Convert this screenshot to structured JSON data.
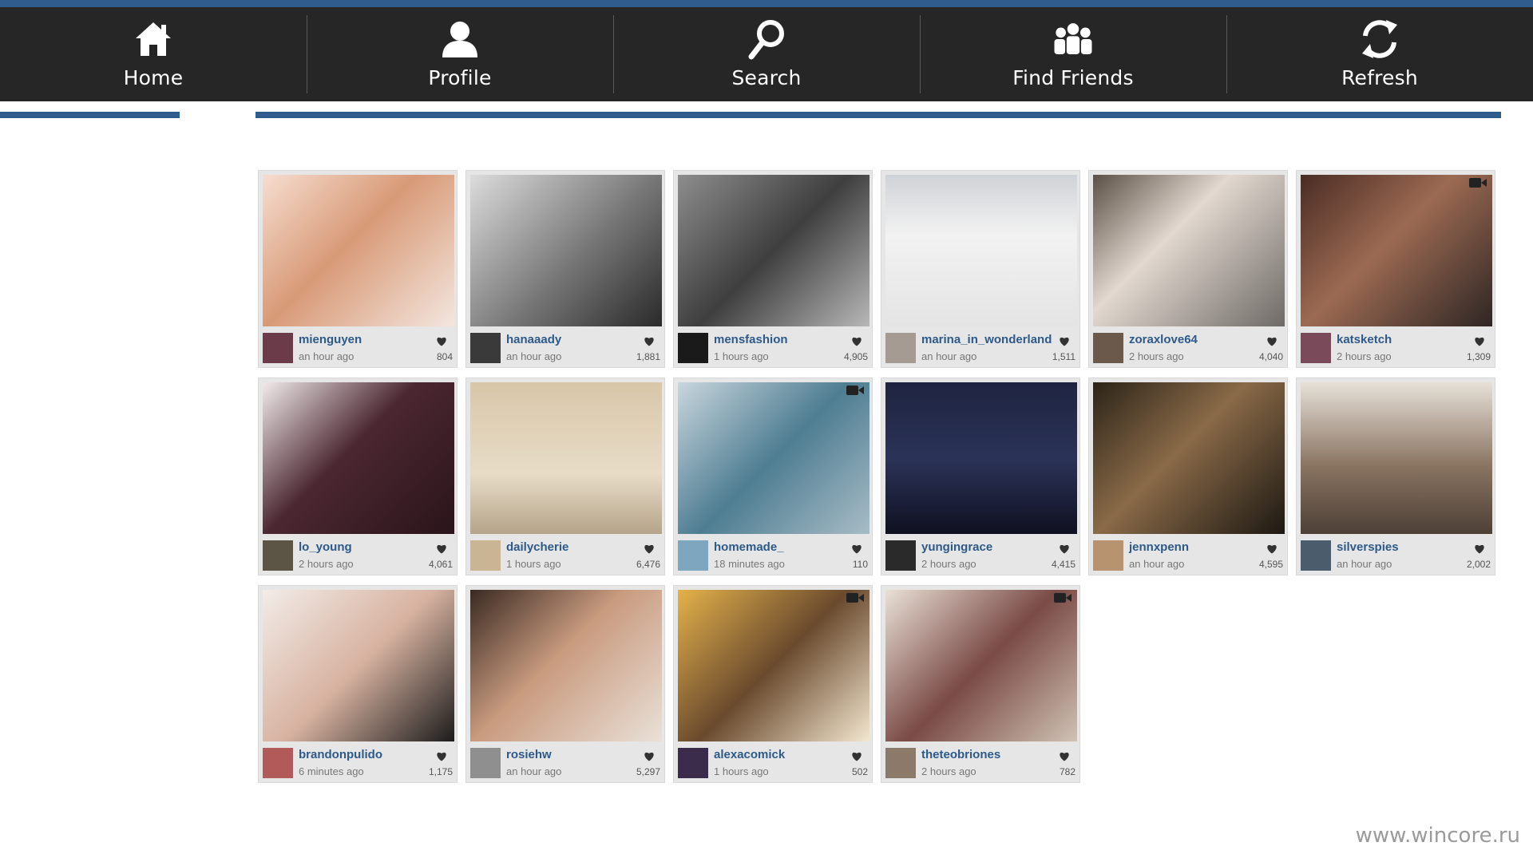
{
  "nav": {
    "items": [
      {
        "label": "Home",
        "icon": "home-icon"
      },
      {
        "label": "Profile",
        "icon": "profile-icon"
      },
      {
        "label": "Search",
        "icon": "search-icon"
      },
      {
        "label": "Find Friends",
        "icon": "friends-icon"
      },
      {
        "label": "Refresh",
        "icon": "refresh-icon"
      }
    ]
  },
  "colors": {
    "accent": "#2f5c8c",
    "appbar": "#262626",
    "username": "#2d5a8a"
  },
  "photos": [
    {
      "user": "mienguyen",
      "time": "an hour ago",
      "likes": "804",
      "bg": "linear-gradient(135deg,#f6ddd0,#d89a77 45%,#f3e6df)",
      "avatar": "#6b3b4a",
      "video": false
    },
    {
      "user": "hanaaady",
      "time": "an hour ago",
      "likes": "1,881",
      "bg": "linear-gradient(135deg,#dcdcdc,#777 55%,#2a2a2a)",
      "avatar": "#3a3a3a",
      "video": false
    },
    {
      "user": "mensfashion",
      "time": "1 hours ago",
      "likes": "4,905",
      "bg": "linear-gradient(135deg,#8d8d8d,#3f3f3f 50%,#b8b8b8)",
      "avatar": "#1a1a1a",
      "video": false
    },
    {
      "user": "marina_in_wonderland",
      "time": "an hour ago",
      "likes": "1,511",
      "bg": "linear-gradient(180deg,#cfd2d6,#f2f2f2 40%,#e4e4e4)",
      "avatar": "#a59b92",
      "video": false
    },
    {
      "user": "zoraxlove64",
      "time": "2 hours ago",
      "likes": "4,040",
      "bg": "linear-gradient(135deg,#5a5046,#e2d8cf 40%,#6e6a66)",
      "avatar": "#6b5a4c",
      "video": false
    },
    {
      "user": "katsketch",
      "time": "2 hours ago",
      "likes": "1,309",
      "bg": "linear-gradient(135deg,#4a2c24,#9c6a52 45%,#2e2624)",
      "avatar": "#7a4a5a",
      "video": true
    },
    {
      "user": "lo_young",
      "time": "2 hours ago",
      "likes": "4,061",
      "bg": "linear-gradient(135deg,#f0eaea,#4b2731 45%,#2a141a)",
      "avatar": "#5c5444",
      "video": false
    },
    {
      "user": "dailycherie",
      "time": "1 hours ago",
      "likes": "6,476",
      "bg": "linear-gradient(180deg,#d8c6a8,#e8dcc7 60%,#b5a48a)",
      "avatar": "#c9b593",
      "video": false
    },
    {
      "user": "homemade_",
      "time": "18 minutes ago",
      "likes": "110",
      "bg": "linear-gradient(135deg,#c9d6dd,#4e7d92 50%,#a8bcc6)",
      "avatar": "#7fa6bf",
      "video": true
    },
    {
      "user": "yungingrace",
      "time": "2 hours ago",
      "likes": "4,415",
      "bg": "linear-gradient(180deg,#1e2440,#2b3358 50%,#0f1020)",
      "avatar": "#2a2a2a",
      "video": false
    },
    {
      "user": "jennxpenn",
      "time": "an hour ago",
      "likes": "4,595",
      "bg": "linear-gradient(135deg,#2b2418,#8a6a48 45%,#1c1812)",
      "avatar": "#b89370",
      "video": false
    },
    {
      "user": "silverspies",
      "time": "an hour ago",
      "likes": "2,002",
      "bg": "linear-gradient(180deg,#e6e1d8,#8a7462 55%,#4d4036)",
      "avatar": "#4b5c6c",
      "video": false
    },
    {
      "user": "brandonpulido",
      "time": "6 minutes ago",
      "likes": "1,175",
      "bg": "linear-gradient(135deg,#f2ece8,#d7b2a0 50%,#1c1c1c)",
      "avatar": "#b25a5a",
      "video": false
    },
    {
      "user": "rosiehw",
      "time": "an hour ago",
      "likes": "5,297",
      "bg": "linear-gradient(135deg,#3a2a22,#c99b7f 45%,#e9e1d8)",
      "avatar": "#8f8f8f",
      "video": false
    },
    {
      "user": "alexacomick",
      "time": "1 hours ago",
      "likes": "502",
      "bg": "linear-gradient(135deg,#e4b24a,#6a4a2e 50%,#f3e7cf)",
      "avatar": "#3c2c4c",
      "video": true
    },
    {
      "user": "theteobriones",
      "time": "2 hours ago",
      "likes": "782",
      "bg": "linear-gradient(135deg,#e9e1d6,#7a4a46 50%,#cfc2b4)",
      "avatar": "#8b7a6a",
      "video": true
    }
  ],
  "watermark": "www.wincore.ru"
}
